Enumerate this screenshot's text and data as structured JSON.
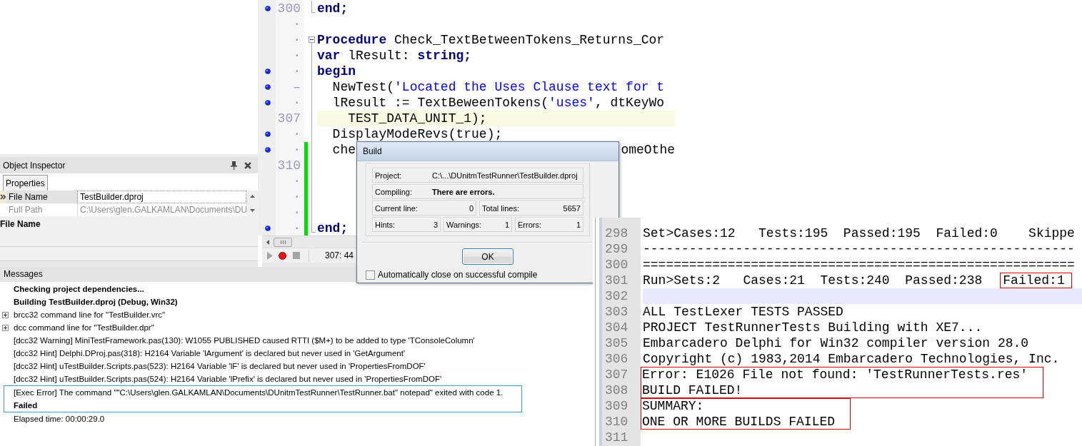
{
  "editor": {
    "lines": [
      {
        "gutter": "300",
        "executable": true,
        "changed": false,
        "current": false,
        "fold": {
          "kind": "end"
        },
        "segments": [
          {
            "kind": "keyword",
            "text": "end;"
          }
        ]
      },
      {
        "gutter": "·",
        "executable": false,
        "changed": false,
        "current": false
      },
      {
        "gutter": "·",
        "executable": false,
        "changed": false,
        "current": false,
        "fold": {
          "kind": "start",
          "expanded": true
        },
        "segments": [
          {
            "kind": "keyword",
            "text": "Procedure"
          },
          {
            "kind": "plain",
            "text": " Check_TextBetweenTokens_Returns_Cor"
          }
        ]
      },
      {
        "gutter": "·",
        "executable": false,
        "changed": false,
        "current": false,
        "fold": {
          "kind": "inside"
        },
        "segments": [
          {
            "kind": "keyword",
            "text": "var"
          },
          {
            "kind": "plain",
            "text": " lResult: "
          },
          {
            "kind": "keyword",
            "text": "string;"
          }
        ]
      },
      {
        "gutter": "·",
        "executable": true,
        "changed": false,
        "current": false,
        "fold": {
          "kind": "inside"
        },
        "segments": [
          {
            "kind": "keyword",
            "text": "begin"
          }
        ]
      },
      {
        "gutter": "–",
        "executable": true,
        "changed": false,
        "current": false,
        "fold": {
          "kind": "inside"
        },
        "segments": [
          {
            "kind": "plain",
            "text": "  NewTest("
          },
          {
            "kind": "string",
            "text": "'Located the Uses Clause text for t"
          }
        ]
      },
      {
        "gutter": "·",
        "executable": true,
        "changed": false,
        "current": false,
        "fold": {
          "kind": "inside"
        },
        "segments": [
          {
            "kind": "plain",
            "text": "  lResult := TextBeweenTokens("
          },
          {
            "kind": "string",
            "text": "'uses'"
          },
          {
            "kind": "plain",
            "text": ", dtKeyWo"
          }
        ]
      },
      {
        "gutter": "307",
        "executable": false,
        "changed": false,
        "current": true,
        "fold": {
          "kind": "inside"
        },
        "segments": [
          {
            "kind": "plain",
            "text": "    TEST_DATA_UNIT_1);"
          }
        ]
      },
      {
        "gutter": "·",
        "executable": true,
        "changed": false,
        "current": false,
        "fold": {
          "kind": "inside"
        },
        "segments": [
          {
            "kind": "plain",
            "text": "  DisplayModeRevs(true);"
          }
        ]
      },
      {
        "gutter": "·",
        "executable": true,
        "changed": true,
        "current": false,
        "fold": {
          "kind": "inside"
        },
        "segments": [
          {
            "kind": "plain",
            "text": "  che"
          }
        ],
        "tail": [
          {
            "kind": "plain",
            "text": "omeOthe"
          }
        ]
      },
      {
        "gutter": "310",
        "executable": false,
        "changed": true,
        "current": false,
        "fold": {
          "kind": "inside"
        }
      },
      {
        "gutter": "·",
        "executable": false,
        "changed": true,
        "current": false,
        "fold": {
          "kind": "inside"
        }
      },
      {
        "gutter": "·",
        "executable": false,
        "changed": true,
        "current": false,
        "fold": {
          "kind": "inside"
        }
      },
      {
        "gutter": "·",
        "executable": false,
        "changed": true,
        "current": false,
        "fold": {
          "kind": "inside"
        }
      },
      {
        "gutter": "·",
        "executable": true,
        "changed": true,
        "current": false,
        "fold": {
          "kind": "end"
        },
        "segments": [
          {
            "kind": "keyword",
            "text": "end;"
          }
        ]
      }
    ],
    "macro_buttons": [
      {
        "kind": "play",
        "disabled": true
      },
      {
        "kind": "record",
        "disabled": false
      },
      {
        "kind": "stop",
        "disabled": true
      }
    ],
    "cursor_position": "307: 44"
  },
  "object_inspector": {
    "title": "Object Inspector",
    "tabs": [
      {
        "label": "Properties",
        "selected": true
      }
    ],
    "properties": [
      {
        "name": "File Name",
        "value": "TestBuilder.dproj",
        "selected": true,
        "disabled": false
      },
      {
        "name": "Full Path",
        "value": "C:\\Users\\glen.GALKAMLAN\\Documents\\DU",
        "selected": false,
        "disabled": true
      }
    ],
    "description": "File Name"
  },
  "build_dialog": {
    "title": "Build",
    "rows": [
      [
        {
          "kind": "text",
          "label": "Project:",
          "value": "C:\\...\\DUnitmTestRunner\\TestBuilder.dproj"
        }
      ],
      [
        {
          "kind": "status",
          "label": "Compiling:",
          "value": "There are errors."
        }
      ],
      [
        {
          "kind": "count",
          "label": "Current line:",
          "value": "0"
        },
        {
          "kind": "count",
          "label": "Total lines:",
          "value": "5657"
        }
      ],
      [
        {
          "kind": "count",
          "label": "Hints:",
          "value": "3"
        },
        {
          "kind": "count",
          "label": "Warnings:",
          "value": "1"
        },
        {
          "kind": "count",
          "label": "Errors:",
          "value": "1"
        }
      ]
    ],
    "ok_button": "OK",
    "auto_close": {
      "label": "Automatically close on successful compile",
      "checked": false
    }
  },
  "messages": {
    "title": "Messages",
    "items": [
      {
        "kind": "heading",
        "text": "Checking project dependencies...",
        "selected": false
      },
      {
        "kind": "heading",
        "text": "Building TestBuilder.dproj (Debug, Win32)",
        "selected": false
      },
      {
        "kind": "expandable",
        "text": "brcc32 command line for \"TestBuilder.vrc\"",
        "expanded": false,
        "selected": false
      },
      {
        "kind": "expandable",
        "text": "dcc command line for \"TestBuilder.dpr\"",
        "expanded": false,
        "selected": false
      },
      {
        "kind": "message",
        "text": "[dcc32 Warning] MiniTestFramework.pas(130): W1055 PUBLISHED caused RTTI ($M+) to be added to type 'TConsoleColumn'",
        "selected": false
      },
      {
        "kind": "message",
        "text": "[dcc32 Hint] Delphi.DProj.pas(318): H2164 Variable 'lArgument' is declared but never used in 'GetArgument'",
        "selected": false
      },
      {
        "kind": "message",
        "text": "[dcc32 Hint] uTestBuilder.Scripts.pas(523): H2164 Variable 'lF' is declared but never used in 'PropertiesFromDOF'",
        "selected": false
      },
      {
        "kind": "message",
        "text": "[dcc32 Hint] uTestBuilder.Scripts.pas(524): H2164 Variable 'lPrefix' is declared but never used in 'PropertiesFromDOF'",
        "selected": false
      },
      {
        "kind": "message",
        "text": "[Exec Error] The command \"\"C:\\Users\\glen.GALKAMLAN\\Documents\\DUnitmTestRunner\\TestRunner.bat\" notepad\" exited with code 1.",
        "selected": true
      },
      {
        "kind": "heading",
        "text": "Failed",
        "selected": true
      },
      {
        "kind": "message",
        "text": "Elapsed time: 00:00:29.0",
        "selected": false
      }
    ]
  },
  "console": {
    "blocks": [
      {
        "framed": false,
        "lines": [
          {
            "number": "298",
            "text": "Set>Cases:12   Tests:195  Passed:195  Failed:0    Skippe",
            "current": false
          },
          {
            "number": "299",
            "text": "--------------------------------------------------------",
            "current": false
          },
          {
            "number": "300",
            "text": "========================================================",
            "current": false
          },
          {
            "number": "301",
            "text": "Run>Sets:2   Cases:21  Tests:240  Passed:238",
            "marked": "Failed:1",
            "current": false
          },
          {
            "number": "302",
            "current": true
          },
          {
            "number": "303",
            "text": "ALL TestLexer TESTS PASSED",
            "current": false
          },
          {
            "number": "304",
            "text": "PROJECT TestRunnerTests Building with XE7...",
            "current": false
          },
          {
            "number": "305",
            "text": "Embarcadero Delphi for Win32 compiler version 28.0",
            "current": false
          },
          {
            "number": "306",
            "text": "Copyright (c) 1983,2014 Embarcadero Technologies, Inc.",
            "current": false
          }
        ]
      },
      {
        "framed": true,
        "lines": [
          {
            "number": "307",
            "text": "Error: E1026 File not found: 'TestRunnerTests.res'",
            "current": false
          },
          {
            "number": "308",
            "text": "BUILD FAILED!",
            "current": false
          }
        ]
      },
      {
        "framed": true,
        "lines": [
          {
            "number": "309",
            "text": "SUMMARY:",
            "current": false
          },
          {
            "number": "310",
            "text": "ONE OR MORE BUILDS FAILED",
            "current": false
          }
        ]
      },
      {
        "framed": false,
        "lines": [
          {
            "number": "311",
            "current": false
          }
        ]
      }
    ]
  }
}
